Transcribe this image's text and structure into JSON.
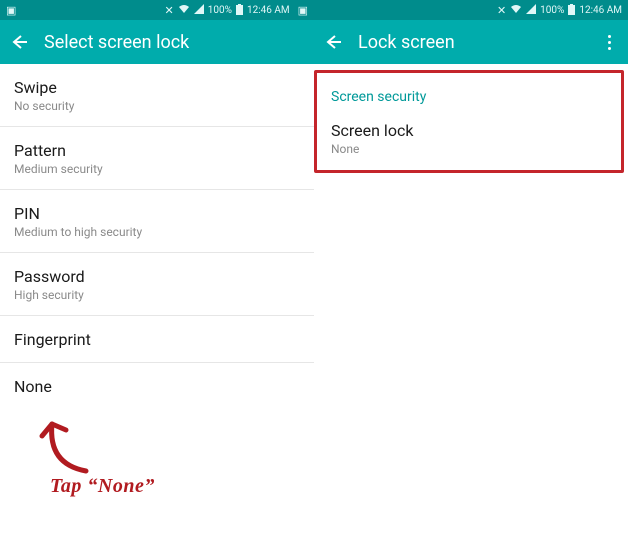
{
  "status": {
    "battery_pct": "100%",
    "time": "12:46 AM"
  },
  "left": {
    "title": "Select screen lock",
    "items": [
      {
        "label": "Swipe",
        "sub": "No security"
      },
      {
        "label": "Pattern",
        "sub": "Medium security"
      },
      {
        "label": "PIN",
        "sub": "Medium to high security"
      },
      {
        "label": "Password",
        "sub": "High security"
      },
      {
        "label": "Fingerprint",
        "sub": ""
      },
      {
        "label": "None",
        "sub": ""
      }
    ]
  },
  "right": {
    "title": "Lock screen",
    "section_header": "Screen security",
    "item": {
      "label": "Screen lock",
      "sub": "None"
    }
  },
  "annotation": {
    "text": "Tap “None”"
  }
}
